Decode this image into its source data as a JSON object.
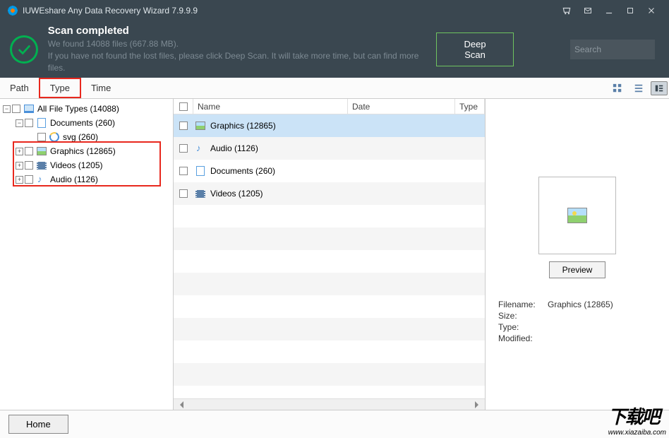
{
  "titlebar": {
    "app_title": "IUWEshare Any Data Recovery Wizard 7.9.9.9"
  },
  "status": {
    "heading": "Scan completed",
    "line1": "We found 14088 files (667.88 MB).",
    "line2": "If you have not found the lost files, please click Deep Scan. It will take more time, but can find more files.",
    "deep_scan_label": "Deep Scan",
    "search_placeholder": "Search"
  },
  "tabs": {
    "path": "Path",
    "type": "Type",
    "time": "Time"
  },
  "tree": {
    "root": "All File Types (14088)",
    "documents": "Documents (260)",
    "svg": "svg (260)",
    "graphics": "Graphics (12865)",
    "videos": "Videos (1205)",
    "audio": "Audio (1126)"
  },
  "list": {
    "headers": {
      "name": "Name",
      "date": "Date",
      "type": "Type"
    },
    "rows": [
      {
        "label": "Graphics (12865)",
        "icon": "img",
        "selected": true
      },
      {
        "label": "Audio (1126)",
        "icon": "audio"
      },
      {
        "label": "Documents (260)",
        "icon": "doc"
      },
      {
        "label": "Videos (1205)",
        "icon": "video"
      }
    ]
  },
  "preview": {
    "button": "Preview",
    "filename_label": "Filename:",
    "filename_value": "Graphics (12865)",
    "size_label": "Size:",
    "type_label": "Type:",
    "modified_label": "Modified:"
  },
  "bottombar": {
    "home": "Home"
  },
  "watermark": {
    "big": "下载吧",
    "small": "www.xiazaiba.com"
  }
}
